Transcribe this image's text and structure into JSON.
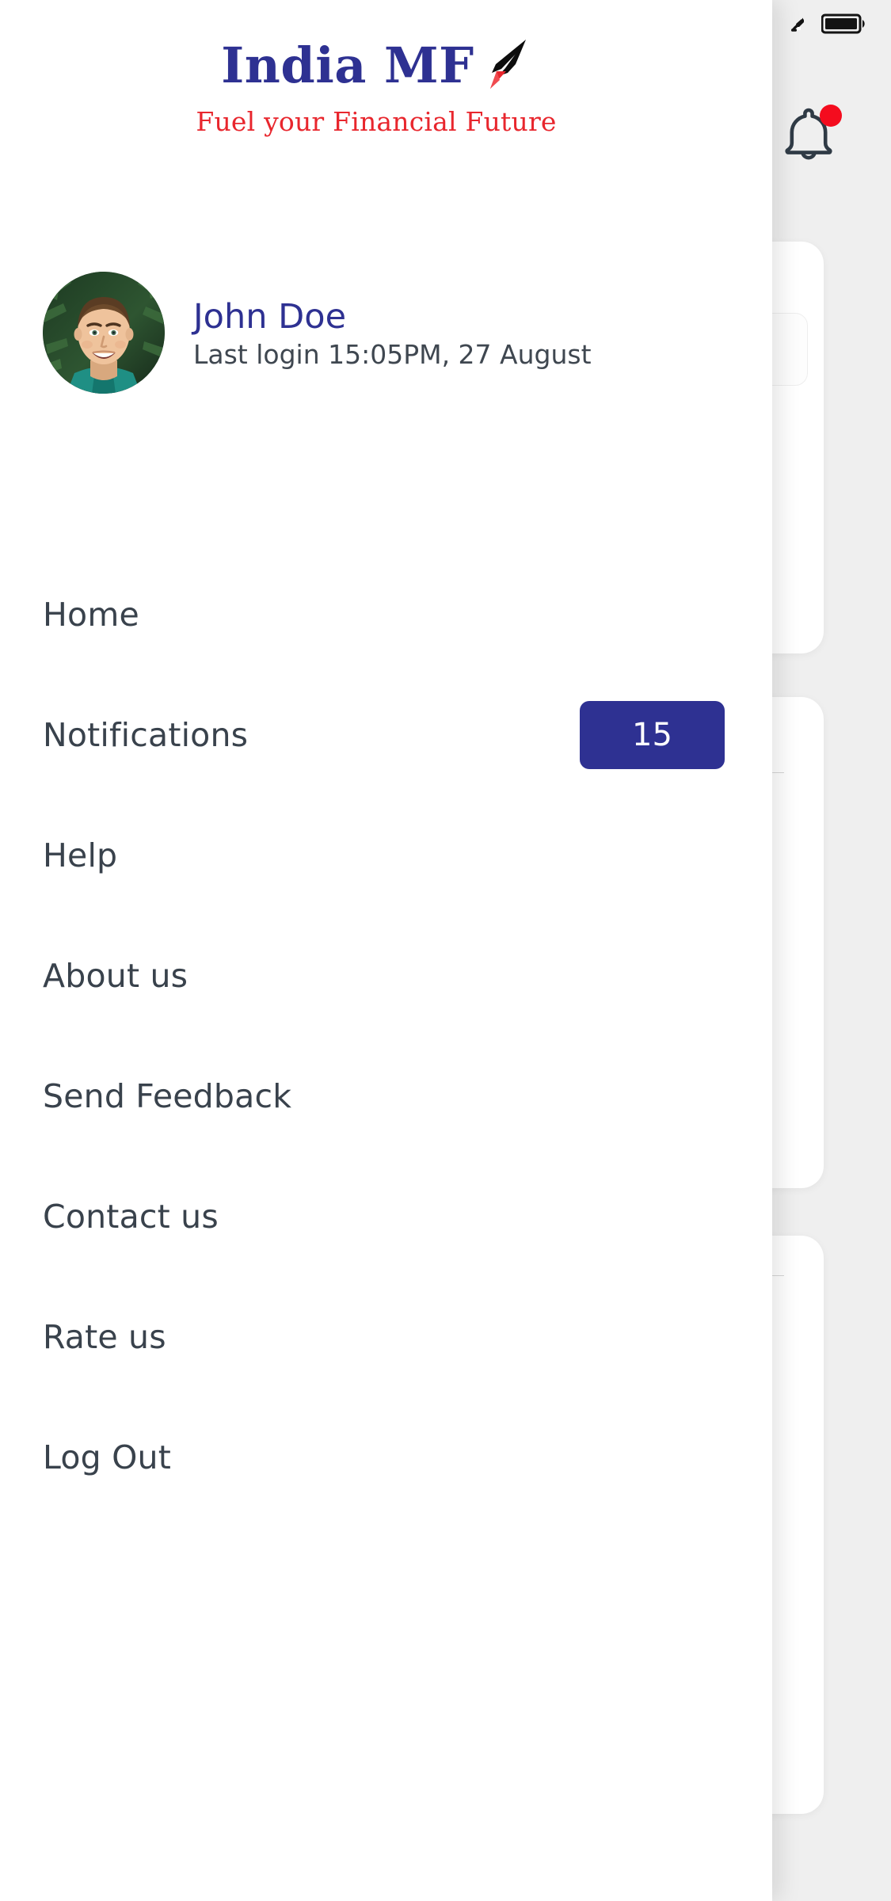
{
  "statusbar": {
    "wifi_icon": "wifi-icon",
    "battery_icon": "battery-full-icon"
  },
  "brand": {
    "name": "India MF",
    "tagline": "Fuel your Financial Future",
    "rocket_icon": "rocket-icon",
    "name_color": "#2e3192",
    "tagline_color": "#e8262d"
  },
  "header": {
    "bell_icon": "bell-icon",
    "bell_badge_color": "#f40c1e",
    "bell_has_unread": true
  },
  "profile": {
    "avatar_icon": "user-avatar-photo",
    "name": "John Doe",
    "last_login": "Last login 15:05PM, 27 August",
    "name_color": "#2e3192"
  },
  "menu": {
    "accent_color": "#2e3192",
    "items": [
      {
        "label": "Home",
        "badge": null
      },
      {
        "label": "Notifications",
        "badge": "15"
      },
      {
        "label": "Help",
        "badge": null
      },
      {
        "label": "About us",
        "badge": null
      },
      {
        "label": "Send Feedback",
        "badge": null
      },
      {
        "label": "Contact us",
        "badge": null
      },
      {
        "label": "Rate us",
        "badge": null
      },
      {
        "label": "Log Out",
        "badge": null
      }
    ]
  }
}
